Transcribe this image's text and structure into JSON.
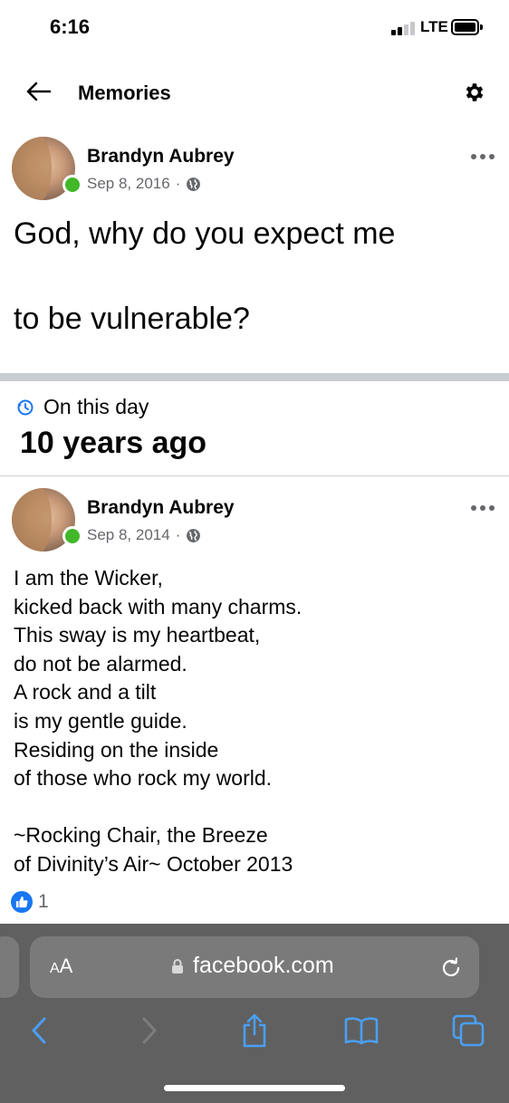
{
  "status_bar": {
    "time": "6:16",
    "network": "LTE"
  },
  "header": {
    "title": "Memories",
    "back_icon": "arrow-left-icon",
    "settings_icon": "gear-icon"
  },
  "memory_post": {
    "author": "Brandyn Aubrey",
    "date": "Sep 8, 2016",
    "separator": "·",
    "audience_icon": "globe-icon",
    "lines": [
      "God, why do you expect me",
      "to be vulnerable?"
    ]
  },
  "on_this_day": {
    "label": "On this day",
    "years_ago": "10 years ago",
    "icon": "clock-history-icon"
  },
  "original_post": {
    "author": "Brandyn Aubrey",
    "date": "Sep 8, 2014",
    "separator": "·",
    "audience_icon": "globe-icon",
    "lines": [
      "I am the Wicker,",
      "kicked back with many charms.",
      "This sway is my heartbeat,",
      "do not be alarmed.",
      "A rock and a tilt",
      "is my gentle guide.",
      "Residing on the inside",
      "of those who rock my world.",
      "",
      "~Rocking Chair, the Breeze",
      "of Divinity’s Air~ October 2013"
    ],
    "like_count": "1"
  },
  "browser": {
    "text_size_label_small": "A",
    "text_size_label_large": "A",
    "url": "facebook.com",
    "icons": {
      "back": "chevron-left-icon",
      "forward": "chevron-right-icon",
      "share": "share-icon",
      "bookmarks": "book-icon",
      "tabs": "tabs-icon",
      "reload": "reload-icon",
      "lock": "lock-icon"
    }
  },
  "colors": {
    "accent": "#1877f2",
    "online": "#42b72a",
    "meta_text": "#65676b",
    "ios_blue": "#4a9ff5",
    "browser_bg": "#606060"
  }
}
